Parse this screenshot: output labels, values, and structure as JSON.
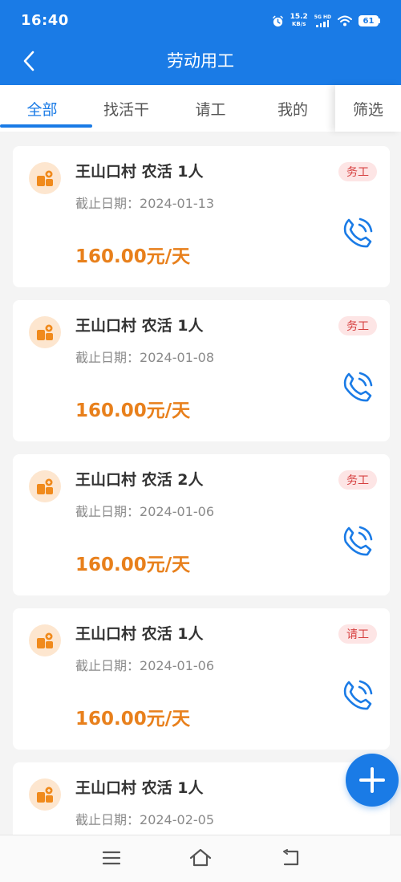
{
  "status_bar": {
    "time": "16:40",
    "net_speed_value": "15.2",
    "net_speed_unit": "KB/s",
    "signal_label": "5G HD",
    "battery": "61"
  },
  "header": {
    "title": "劳动用工",
    "back_icon": "chevron-left-icon"
  },
  "tabs": [
    {
      "label": "全部",
      "active": true
    },
    {
      "label": "找活干",
      "active": false
    },
    {
      "label": "请工",
      "active": false
    },
    {
      "label": "我的",
      "active": false
    }
  ],
  "filter_label": "筛选",
  "deadline_label": "截止日期：",
  "jobs": [
    {
      "title": "王山口村 农活 1人",
      "deadline": "2024-01-13",
      "price": "160.00元/天",
      "type": "务工"
    },
    {
      "title": "王山口村 农活 1人",
      "deadline": "2024-01-08",
      "price": "160.00元/天",
      "type": "务工"
    },
    {
      "title": "王山口村 农活 2人",
      "deadline": "2024-01-06",
      "price": "160.00元/天",
      "type": "务工"
    },
    {
      "title": "王山口村 农活 1人",
      "deadline": "2024-01-06",
      "price": "160.00元/天",
      "type": "请工"
    },
    {
      "title": "王山口村 农活 1人",
      "deadline": "2024-02-05",
      "price": "",
      "type": ""
    }
  ],
  "colors": {
    "primary": "#1a7be6",
    "price": "#e8801c",
    "badge_text": "#d64040",
    "badge_bg": "#fde5e5",
    "avatar_bg": "#fde6cf"
  },
  "icons": {
    "avatar": "worker-tools-icon",
    "call": "phone-call-icon",
    "fab": "plus-icon",
    "nav": [
      "menu-icon",
      "home-icon",
      "back-arrow-icon"
    ]
  }
}
